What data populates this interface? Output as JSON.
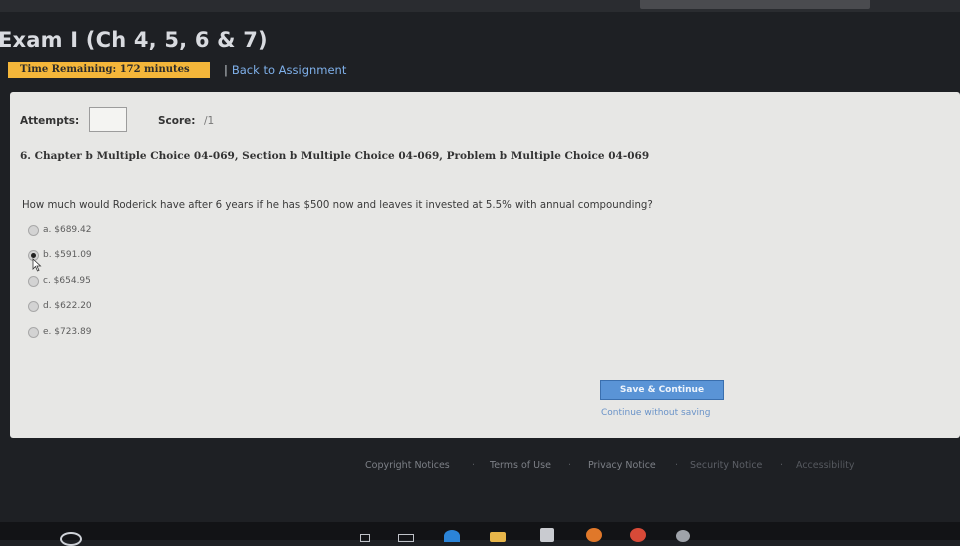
{
  "header": {
    "exam_title": "Exam I (Ch 4, 5, 6 & 7)",
    "time_remaining": "Time Remaining: 172 minutes",
    "back_link_separator": "|",
    "back_link": "Back to Assignment"
  },
  "panel": {
    "attempts_label": "Attempts:",
    "attempts_value": "",
    "score_label": "Score:",
    "score_value": "/1",
    "question_heading": "6. Chapter b Multiple Choice 04-069, Section b Multiple Choice 04-069, Problem b Multiple Choice 04-069",
    "question_text": "How much would Roderick have after 6 years if he has $500 now and leaves it invested at 5.5% with annual compounding?",
    "options": [
      {
        "label": "a. $689.42",
        "selected": false
      },
      {
        "label": "b. $591.09",
        "selected": true
      },
      {
        "label": "c. $654.95",
        "selected": false
      },
      {
        "label": "d. $622.20",
        "selected": false
      },
      {
        "label": "e. $723.89",
        "selected": false
      }
    ],
    "save_button": "Save & Continue",
    "continue_link": "Continue without saving"
  },
  "footer": {
    "copyright": "Copyright Notices",
    "terms": "Terms of Use",
    "privacy": "Privacy Notice",
    "security": "Security Notice",
    "accessibility": "Accessibility",
    "separator": "·"
  },
  "taskbar": {
    "icons": [
      "search-icon",
      "task-view-icon",
      "edge-icon",
      "file-explorer-icon",
      "store-icon",
      "firefox-icon",
      "chrome-icon",
      "app-icon"
    ]
  },
  "colors": {
    "time_box": "#f4b63a",
    "link": "#7fb0ea",
    "save_button": "#5a94d6",
    "panel_bg": "#e7e7e5",
    "page_bg": "#1e2024"
  }
}
